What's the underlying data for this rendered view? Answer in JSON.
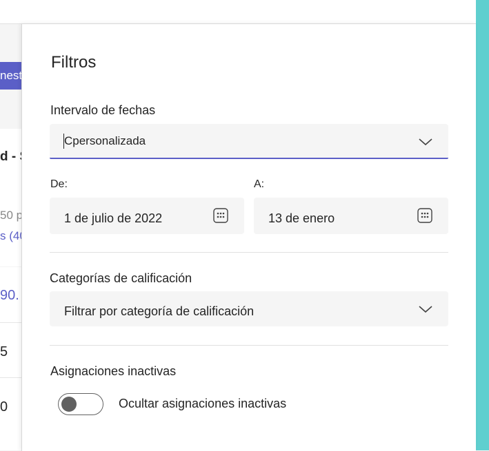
{
  "background": {
    "pill_text": "nest",
    "card_text": "d - S",
    "line1": "50 p",
    "line2": "s (40",
    "line3": "90.",
    "row1": "5",
    "row2": "0"
  },
  "panel": {
    "title": "Filtros",
    "date_range": {
      "label": "Intervalo de fechas",
      "value": "Cpersonalizada"
    },
    "from": {
      "label": "De:",
      "value": "1 de julio de 2022"
    },
    "to": {
      "label": "A:",
      "value": "13 de enero"
    },
    "grading": {
      "label": "Categorías de calificación",
      "placeholder": "Filtrar por categoría de calificación"
    },
    "inactive": {
      "label": "Asignaciones inactivas",
      "toggle_label": "Ocultar asignaciones inactivas",
      "toggle_on": false
    }
  },
  "colors": {
    "accent": "#5b5fc7",
    "teal": "#5fcfcf",
    "field_bg": "#f5f5f5"
  }
}
